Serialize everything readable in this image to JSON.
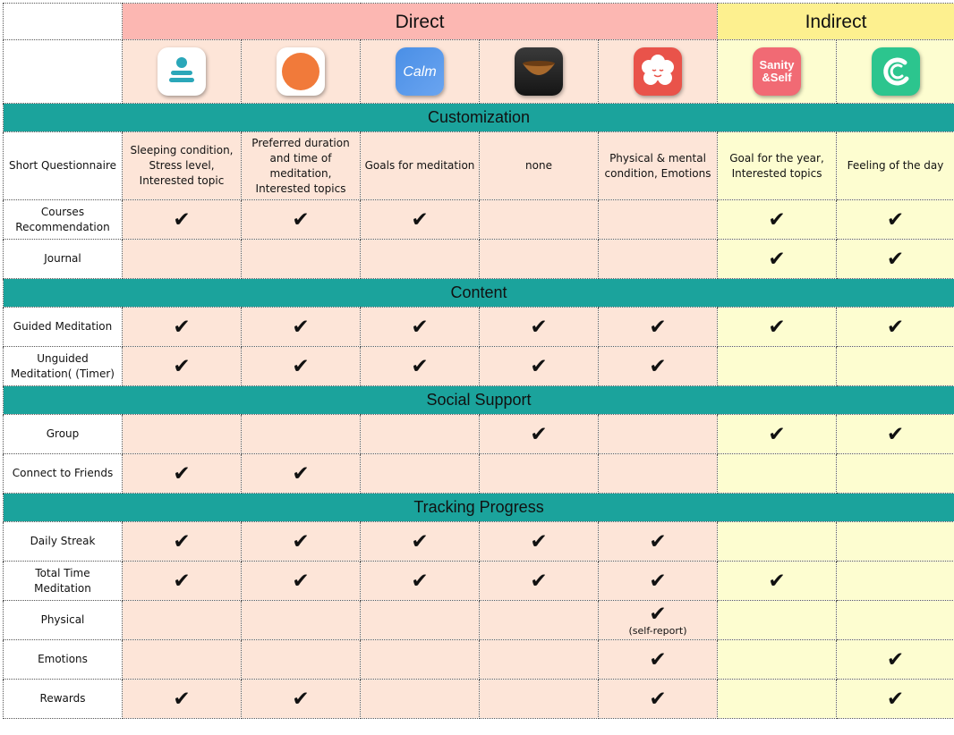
{
  "groups": {
    "direct": "Direct",
    "indirect": "Indirect"
  },
  "apps": [
    {
      "icon": "headspace-style-meditation-icon",
      "group": "direct",
      "color": "#ffffff"
    },
    {
      "icon": "orange-circle-app-icon",
      "group": "direct",
      "color": "#f17a3a"
    },
    {
      "icon": "calm-app-icon",
      "group": "direct",
      "label": "Calm",
      "color": "#3b7fe0"
    },
    {
      "icon": "singing-bowl-app-icon",
      "group": "direct",
      "color": "#2b2b2b"
    },
    {
      "icon": "smiling-mind-flower-icon",
      "group": "direct",
      "color": "#e9534a"
    },
    {
      "icon": "sanity-and-self-app-icon",
      "group": "indirect",
      "label_line1": "Sanity",
      "label_line2": "&Self",
      "color": "#f16a74"
    },
    {
      "icon": "green-swirl-app-icon",
      "group": "indirect",
      "color": "#2cc58e"
    }
  ],
  "sections": [
    {
      "title": "Customization",
      "rows": [
        {
          "label": "Short Questionnaire",
          "cells": [
            "Sleeping condition, Stress level, Interested topic",
            "Preferred duration and time of meditation, Interested topics",
            "Goals for meditation",
            "none",
            "Physical & mental condition, Emotions",
            "Goal for the year, Interested topics",
            "Feeling of the day"
          ]
        },
        {
          "label": "Courses Recommendation",
          "cells": [
            "✔",
            "✔",
            "✔",
            "",
            "",
            "✔",
            "✔"
          ]
        },
        {
          "label": "Journal",
          "cells": [
            "",
            "",
            "",
            "",
            "",
            "✔",
            "✔"
          ]
        }
      ]
    },
    {
      "title": "Content",
      "rows": [
        {
          "label": "Guided Meditation",
          "cells": [
            "✔",
            "✔",
            "✔",
            "✔",
            "✔",
            "✔",
            "✔"
          ]
        },
        {
          "label": "Unguided Meditation( (Timer)",
          "cells": [
            "✔",
            "✔",
            "✔",
            "✔",
            "✔",
            "",
            ""
          ]
        }
      ]
    },
    {
      "title": "Social Support",
      "rows": [
        {
          "label": "Group",
          "cells": [
            "",
            "",
            "",
            "✔",
            "",
            "✔",
            "✔"
          ]
        },
        {
          "label": "Connect to Friends",
          "cells": [
            "✔",
            "✔",
            "",
            "",
            "",
            "",
            ""
          ]
        }
      ]
    },
    {
      "title": "Tracking Progress",
      "rows": [
        {
          "label": "Daily Streak",
          "cells": [
            "✔",
            "✔",
            "✔",
            "✔",
            "✔",
            "",
            ""
          ]
        },
        {
          "label": "Total Time Meditation",
          "cells": [
            "✔",
            "✔",
            "✔",
            "✔",
            "✔",
            "✔",
            ""
          ]
        },
        {
          "label": "Physical",
          "cells": [
            "",
            "",
            "",
            "",
            "✔",
            "",
            ""
          ],
          "notes": [
            "",
            "",
            "",
            "",
            "(self-report)",
            "",
            ""
          ]
        },
        {
          "label": "Emotions",
          "cells": [
            "",
            "",
            "",
            "",
            "✔",
            "",
            "✔"
          ]
        },
        {
          "label": "Rewards",
          "cells": [
            "✔",
            "✔",
            "",
            "",
            "✔",
            "",
            "✔"
          ]
        }
      ]
    }
  ]
}
